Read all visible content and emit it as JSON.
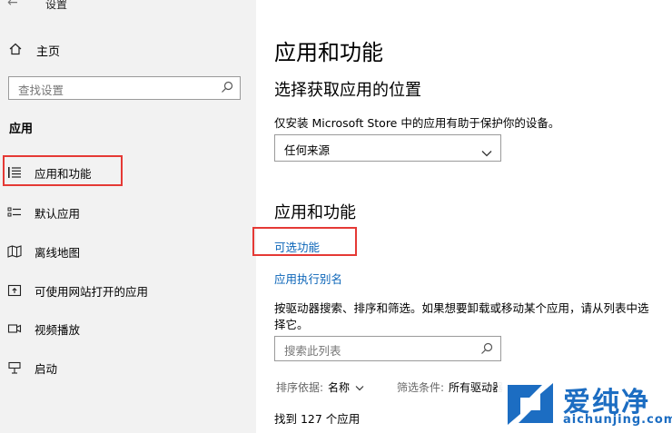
{
  "window": {
    "title": "设置",
    "back_glyph": "←"
  },
  "sidebar": {
    "home_label": "主页",
    "search_placeholder": "查找设置",
    "section_heading": "应用",
    "items": [
      {
        "label": "应用和功能",
        "icon": "apps-list-icon",
        "selected": true
      },
      {
        "label": "默认应用",
        "icon": "default-apps-icon"
      },
      {
        "label": "离线地图",
        "icon": "map-icon"
      },
      {
        "label": "可使用网站打开的应用",
        "icon": "open-website-icon"
      },
      {
        "label": "视频播放",
        "icon": "video-icon"
      },
      {
        "label": "启动",
        "icon": "startup-icon"
      }
    ]
  },
  "main": {
    "title": "应用和功能",
    "install_section": {
      "title": "选择获取应用的位置",
      "description": "仅安装 Microsoft Store 中的应用有助于保护你的设备。",
      "dropdown_value": "任何来源"
    },
    "apps_section": {
      "title": "应用和功能",
      "optional_features_link": "可选功能",
      "app_alias_link": "应用执行别名",
      "description": "按驱动器搜索、排序和筛选。如果想要卸载或移动某个应用，请从列表中选择它。",
      "search_placeholder": "搜索此列表",
      "sort_label": "排序依据:",
      "sort_value": "名称",
      "filter_label": "筛选条件:",
      "filter_value": "所有驱动器",
      "found_text": "找到 127 个应用"
    }
  },
  "watermark": {
    "cn": "爱纯净",
    "en": "aichunjing.com"
  },
  "colors": {
    "accent_link": "#0a64b8",
    "highlight_box": "#e53935",
    "sidebar_bg": "#f2f2f2"
  }
}
